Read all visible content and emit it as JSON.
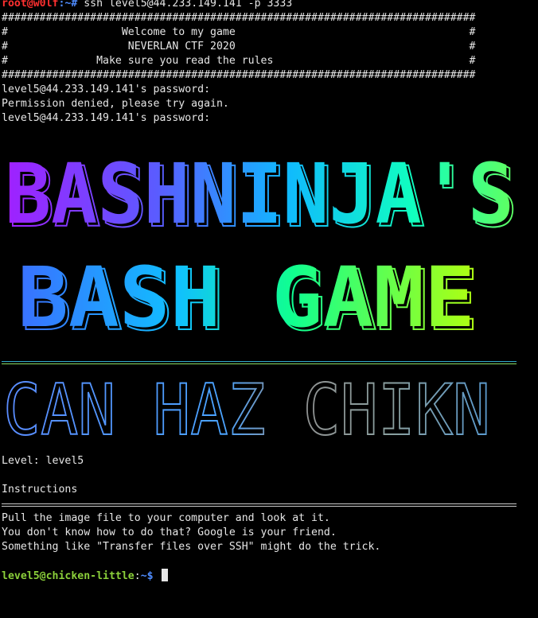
{
  "terminal": {
    "cmd_prompt_user": "root@w0lf",
    "cmd_prompt_path": ":~#",
    "cmd_text": " ssh level5@44.233.149.141 -p 3333",
    "motd": [
      "###########################################################################",
      "#                  Welcome to my game                                     #",
      "#                   NEVERLAN CTF 2020                                     #",
      "#              Make sure you read the rules                               #",
      "###########################################################################"
    ],
    "pw_prompt_1": "level5@44.233.149.141's password:",
    "denied": "Permission denied, please try again.",
    "pw_prompt_2": "level5@44.233.149.141's password:",
    "banner_line_1": "BASHNINJA'S",
    "banner_line_2": "BASH GAME",
    "ascii_title": "CAN HAZ CHIKN",
    "level_label": "Level: level5",
    "instructions_label": "Instructions",
    "instructions": [
      "Pull the image file to your computer and look at it.",
      "You don't know how to do that? Google is your friend.",
      "Something like \"Transfer files over SSH\" might do the trick."
    ],
    "final_prompt_user": "level5@chicken-little",
    "final_prompt_colon": ":",
    "final_prompt_path": "~$"
  },
  "colors": {
    "background": "#000000",
    "text": "#e6e6e6",
    "root_prompt": "#ff3030",
    "path": "#4f8cff",
    "user_prompt": "#8bd03a"
  }
}
